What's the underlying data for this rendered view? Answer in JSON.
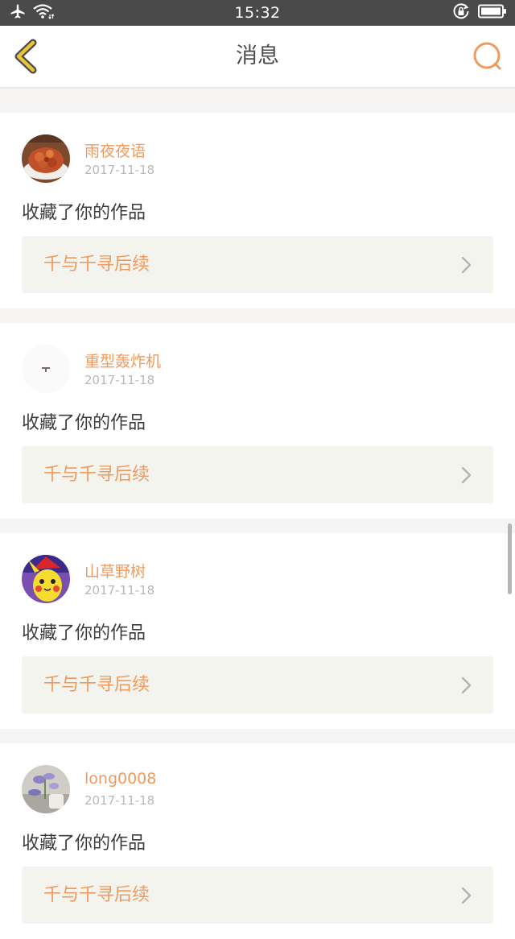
{
  "status_bar": {
    "time": "15:32",
    "icons": [
      "airplane-icon",
      "wifi-icon",
      "rotation-lock-icon",
      "battery-icon"
    ]
  },
  "header": {
    "title": "消息",
    "back_icon": "chevron-left-icon",
    "search_icon": "search-icon"
  },
  "colors": {
    "accent": "#ef9a5e",
    "back_arrow": "#e8c43a",
    "status_bar_bg": "#4a4a4a",
    "page_bg": "#f7f5f3",
    "work_link_bg": "#f4f4ef"
  },
  "messages": [
    {
      "username": "雨夜夜语",
      "date": "2017-11-18",
      "action": "收藏了你的作品",
      "work_title": "千与千寻后续",
      "avatar": "food-dish-avatar"
    },
    {
      "username": "重型轰炸机",
      "date": "2017-11-18",
      "action": "收藏了你的作品",
      "work_title": "千与千寻后续",
      "avatar": "tiny-logo-avatar"
    },
    {
      "username": "山草野树",
      "date": "2017-11-18",
      "action": "收藏了你的作品",
      "work_title": "千与千寻后续",
      "avatar": "pikachu-avatar"
    },
    {
      "username": "long0008",
      "date": "2017-11-18",
      "action": "收藏了你的作品",
      "work_title": "千与千寻后续",
      "avatar": "lavender-avatar"
    }
  ]
}
